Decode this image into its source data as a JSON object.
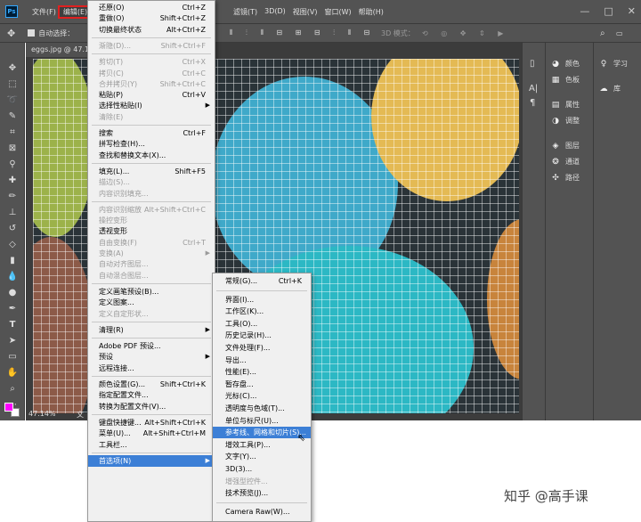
{
  "app": {
    "logo": "Ps"
  },
  "menubar": {
    "items": [
      "文件(F)",
      "编辑(E)",
      "图像(I)",
      "图层(L)",
      "文字(Y)",
      "选择(S)",
      "滤镜(T)",
      "3D(D)",
      "视图(V)",
      "窗口(W)",
      "帮助(H)"
    ],
    "active_index": 1,
    "visible_right": [
      "滤镜(T)",
      "3D(D)",
      "视图(V)",
      "窗口(W)",
      "帮助(H)"
    ]
  },
  "options_bar": {
    "auto_select": "自动选择：",
    "mode_3d": "3D 模式："
  },
  "document": {
    "tab": "eggs.jpg @ 47.1",
    "zoom": "47.14%",
    "status_prefix": "文"
  },
  "edit_menu": {
    "items": [
      {
        "label": "还原(O)",
        "shortcut": "Ctrl+Z",
        "disabled": false
      },
      {
        "label": "重做(O)",
        "shortcut": "Shift+Ctrl+Z",
        "disabled": false
      },
      {
        "label": "切换最终状态",
        "shortcut": "Alt+Ctrl+Z",
        "disabled": false
      },
      {
        "sep": true
      },
      {
        "label": "渐隐(D)...",
        "shortcut": "Shift+Ctrl+F",
        "disabled": true
      },
      {
        "sep": true
      },
      {
        "label": "剪切(T)",
        "shortcut": "Ctrl+X",
        "disabled": true
      },
      {
        "label": "拷贝(C)",
        "shortcut": "Ctrl+C",
        "disabled": true
      },
      {
        "label": "合并拷贝(Y)",
        "shortcut": "Shift+Ctrl+C",
        "disabled": true
      },
      {
        "label": "粘贴(P)",
        "shortcut": "Ctrl+V",
        "disabled": false
      },
      {
        "label": "选择性粘贴(I)",
        "shortcut": "",
        "disabled": false,
        "submenu": true
      },
      {
        "label": "清除(E)",
        "shortcut": "",
        "disabled": true
      },
      {
        "sep": true
      },
      {
        "label": "搜索",
        "shortcut": "Ctrl+F",
        "disabled": false
      },
      {
        "label": "拼写检查(H)...",
        "shortcut": "",
        "disabled": false
      },
      {
        "label": "查找和替换文本(X)...",
        "shortcut": "",
        "disabled": false
      },
      {
        "sep": true
      },
      {
        "label": "填充(L)...",
        "shortcut": "Shift+F5",
        "disabled": false
      },
      {
        "label": "描边(S)...",
        "shortcut": "",
        "disabled": true
      },
      {
        "label": "内容识别填充...",
        "shortcut": "",
        "disabled": true
      },
      {
        "sep": true
      },
      {
        "label": "内容识别缩放",
        "shortcut": "Alt+Shift+Ctrl+C",
        "disabled": true
      },
      {
        "label": "操控变形",
        "shortcut": "",
        "disabled": true
      },
      {
        "label": "透视变形",
        "shortcut": "",
        "disabled": false
      },
      {
        "label": "自由变换(F)",
        "shortcut": "Ctrl+T",
        "disabled": true
      },
      {
        "label": "变换(A)",
        "shortcut": "",
        "disabled": true,
        "submenu": true
      },
      {
        "label": "自动对齐图层...",
        "shortcut": "",
        "disabled": true
      },
      {
        "label": "自动混合图层...",
        "shortcut": "",
        "disabled": true
      },
      {
        "sep": true
      },
      {
        "label": "定义画笔预设(B)...",
        "shortcut": "",
        "disabled": false
      },
      {
        "label": "定义图案...",
        "shortcut": "",
        "disabled": false
      },
      {
        "label": "定义自定形状...",
        "shortcut": "",
        "disabled": true
      },
      {
        "sep": true
      },
      {
        "label": "清理(R)",
        "shortcut": "",
        "disabled": false,
        "submenu": true
      },
      {
        "sep": true
      },
      {
        "label": "Adobe PDF 预设...",
        "shortcut": "",
        "disabled": false
      },
      {
        "label": "预设",
        "shortcut": "",
        "disabled": false,
        "submenu": true
      },
      {
        "label": "远程连接...",
        "shortcut": "",
        "disabled": false
      },
      {
        "sep": true
      },
      {
        "label": "颜色设置(G)...",
        "shortcut": "Shift+Ctrl+K",
        "disabled": false
      },
      {
        "label": "指定配置文件...",
        "shortcut": "",
        "disabled": false
      },
      {
        "label": "转换为配置文件(V)...",
        "shortcut": "",
        "disabled": false
      },
      {
        "sep": true
      },
      {
        "label": "键盘快捷键...",
        "shortcut": "Alt+Shift+Ctrl+K",
        "disabled": false
      },
      {
        "label": "菜单(U)...",
        "shortcut": "Alt+Shift+Ctrl+M",
        "disabled": false
      },
      {
        "label": "工具栏...",
        "shortcut": "",
        "disabled": false
      },
      {
        "sep": true
      },
      {
        "label": "首选项(N)",
        "shortcut": "",
        "disabled": false,
        "submenu": true,
        "highlight": true
      }
    ]
  },
  "prefs_submenu": {
    "items": [
      {
        "label": "常规(G)...",
        "shortcut": "Ctrl+K"
      },
      {
        "sep": true
      },
      {
        "label": "界面(I)..."
      },
      {
        "label": "工作区(K)..."
      },
      {
        "label": "工具(O)..."
      },
      {
        "label": "历史记录(H)..."
      },
      {
        "label": "文件处理(F)..."
      },
      {
        "label": "导出..."
      },
      {
        "label": "性能(E)..."
      },
      {
        "label": "暂存盘..."
      },
      {
        "label": "光标(C)..."
      },
      {
        "label": "透明度与色域(T)..."
      },
      {
        "label": "单位与标尺(U)..."
      },
      {
        "label": "参考线、网格和切片(S)...",
        "highlight": true
      },
      {
        "label": "增效工具(P)..."
      },
      {
        "label": "文字(Y)..."
      },
      {
        "label": "3D(3)..."
      },
      {
        "label": "增强型控件...",
        "disabled": true
      },
      {
        "label": "技术预览(J)..."
      },
      {
        "sep": true
      },
      {
        "label": "Camera Raw(W)..."
      }
    ]
  },
  "panels": {
    "col1": [
      "颜色",
      "色板",
      "属性",
      "调整",
      "图层",
      "通道",
      "路径"
    ],
    "col2": [
      "学习",
      "库"
    ]
  },
  "watermark": "知乎 @高手课"
}
